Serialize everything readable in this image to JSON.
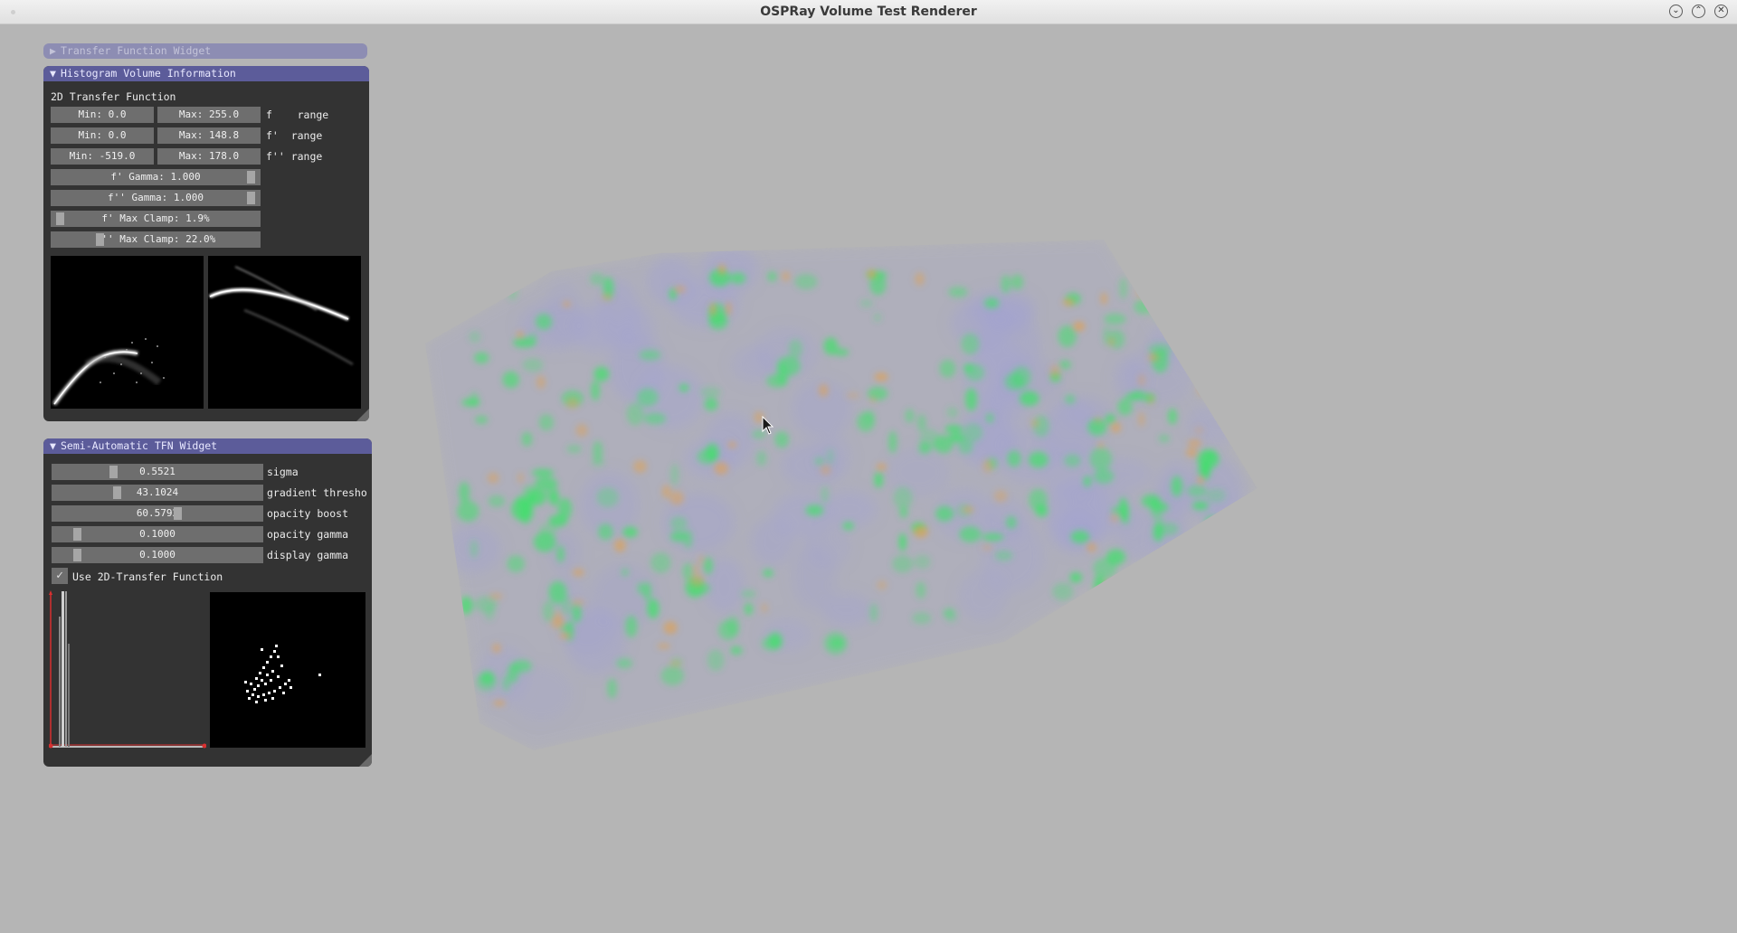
{
  "window": {
    "title": "OSPRay Volume Test Renderer"
  },
  "transfer_function_widget": {
    "title": "Transfer Function Widget"
  },
  "histogram_panel": {
    "title": "Histogram Volume Information",
    "section_label": "2D Transfer Function",
    "ranges": [
      {
        "min": "Min: 0.0",
        "max": "Max: 255.0",
        "label": "f    range"
      },
      {
        "min": "Min: 0.0",
        "max": "Max: 148.8",
        "label": "f'  range"
      },
      {
        "min": "Min: -519.0",
        "max": "Max: 178.0",
        "label": "f'' range"
      }
    ],
    "sliders": [
      {
        "text": "f'  Gamma: 1.000",
        "position": 0.98
      },
      {
        "text": "f'' Gamma: 1.000",
        "position": 0.98
      },
      {
        "text": "f'  Max Clamp: 1.9%",
        "position": 0.02
      },
      {
        "text": "f'' Max Clamp: 22.0%",
        "position": 0.22
      }
    ]
  },
  "semi_auto_panel": {
    "title": "Semi-Automatic TFN Widget",
    "sliders": [
      {
        "value": "0.5521",
        "label": "sigma",
        "position": 0.28
      },
      {
        "value": "43.1024",
        "label": "gradient thresho",
        "position": 0.3
      },
      {
        "value": "60.5792",
        "label": "opacity boost",
        "position": 0.6
      },
      {
        "value": "0.1000",
        "label": "opacity gamma",
        "position": 0.1
      },
      {
        "value": "0.1000",
        "label": "display gamma",
        "position": 0.1
      }
    ],
    "checkbox": {
      "label": "Use 2D-Transfer Function",
      "checked": true
    }
  },
  "colors": {
    "panel_bg": "#333333",
    "header_active": "#5c5c9a",
    "header_collapsed": "#8d8db3",
    "field_bg": "#6e6e6e",
    "desktop_bg": "#b5b5b5",
    "volume_green": "#3fe06a",
    "volume_orange": "#e0a050",
    "volume_lavender": "#a3a3d0"
  },
  "icons": {
    "window_buttons": [
      "minimize-icon",
      "maximize-icon",
      "close-icon"
    ],
    "cursor": "mouse-pointer-icon"
  }
}
